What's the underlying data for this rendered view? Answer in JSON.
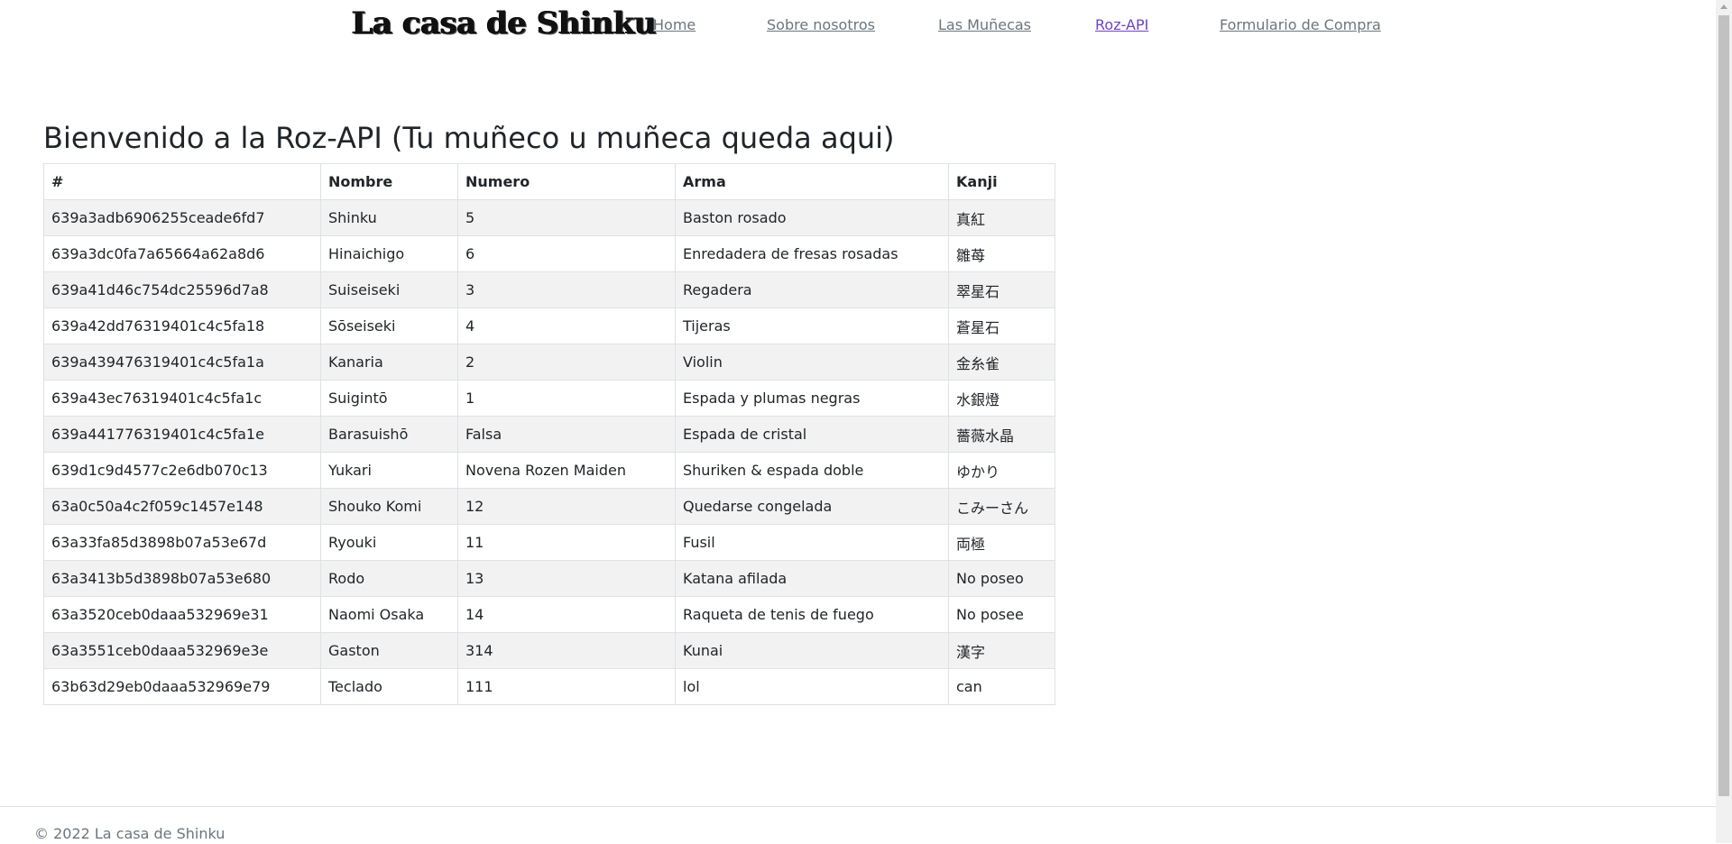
{
  "header": {
    "logo": "La casa de Shinku",
    "nav": [
      {
        "label": "Home"
      },
      {
        "label": "Sobre nosotros"
      },
      {
        "label": "Las Muñecas"
      },
      {
        "label": "Roz-API",
        "active": true
      },
      {
        "label": "Formulario de Compra"
      }
    ]
  },
  "main": {
    "title": "Bienvenido a la Roz-API (Tu muñeco u muñeca queda aqui)",
    "table": {
      "headers": [
        "#",
        "Nombre",
        "Numero",
        "Arma",
        "Kanji"
      ],
      "rows": [
        [
          "639a3adb6906255ceade6fd7",
          "Shinku",
          "5",
          "Baston rosado",
          "真紅"
        ],
        [
          "639a3dc0fa7a65664a62a8d6",
          "Hinaichigo",
          "6",
          "Enredadera de fresas rosadas",
          "雛苺"
        ],
        [
          "639a41d46c754dc25596d7a8",
          "Suiseiseki",
          "3",
          "Regadera",
          "翠星石"
        ],
        [
          "639a42dd76319401c4c5fa18",
          "Sōseiseki",
          "4",
          "Tijeras",
          "蒼星石"
        ],
        [
          "639a439476319401c4c5fa1a",
          "Kanaria",
          "2",
          "Violin",
          "金糸雀"
        ],
        [
          "639a43ec76319401c4c5fa1c",
          "Suigintō",
          "1",
          "Espada y plumas negras",
          "水銀燈"
        ],
        [
          "639a441776319401c4c5fa1e",
          "Barasuishō",
          "Falsa",
          "Espada de cristal",
          "薔薇水晶"
        ],
        [
          "639d1c9d4577c2e6db070c13",
          "Yukari",
          "Novena Rozen Maiden",
          "Shuriken & espada doble",
          "ゆかり"
        ],
        [
          "63a0c50a4c2f059c1457e148",
          "Shouko Komi",
          "12",
          "Quedarse congelada",
          "こみーさん"
        ],
        [
          "63a33fa85d3898b07a53e67d",
          "Ryouki",
          "11",
          "Fusil",
          "両極"
        ],
        [
          "63a3413b5d3898b07a53e680",
          "Rodo",
          "13",
          "Katana afilada",
          "No poseo"
        ],
        [
          "63a3520ceb0daaa532969e31",
          "Naomi Osaka",
          "14",
          "Raqueta de tenis de fuego",
          "No posee"
        ],
        [
          "63a3551ceb0daaa532969e3e",
          "Gaston",
          "314",
          "Kunai",
          "漢字"
        ],
        [
          "63b63d29eb0daaa532969e79",
          "Teclado",
          "111",
          "lol",
          "can"
        ]
      ]
    }
  },
  "footer": {
    "text": "© 2022 La casa de Shinku"
  }
}
